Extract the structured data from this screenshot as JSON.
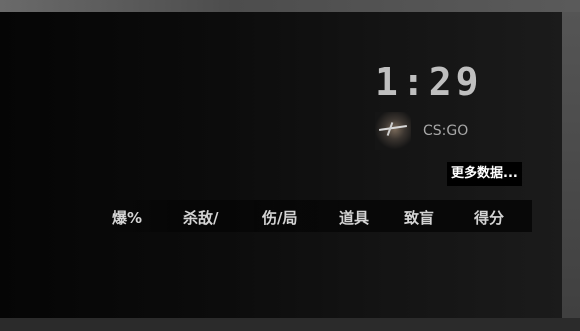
{
  "timer": "1:29",
  "map": {
    "name": "CS:GO",
    "icon": "map-thumbnail"
  },
  "more_button": "更多数据...",
  "columns": [
    "爆%",
    "杀敌/",
    "伤/局",
    "道具",
    "致盲",
    "得分"
  ]
}
